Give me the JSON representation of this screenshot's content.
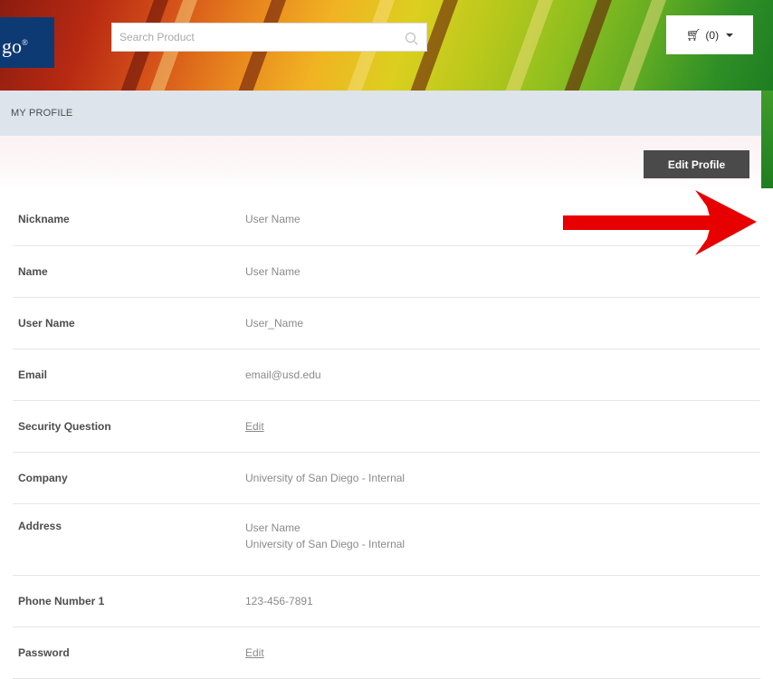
{
  "header": {
    "logo_text": "go",
    "logo_mark": "®",
    "search_placeholder": "Search Product",
    "search_icon": "search-icon",
    "cart_label": "(0)",
    "cart_icon": "cart-icon"
  },
  "page": {
    "title": "MY PROFILE",
    "edit_button": "Edit Profile"
  },
  "profile": {
    "nickname": {
      "label": "Nickname",
      "value": "User Name"
    },
    "name": {
      "label": "Name",
      "value": "User Name"
    },
    "username": {
      "label": "User Name",
      "value": "User_Name"
    },
    "email": {
      "label": "Email",
      "value": "email@usd.edu"
    },
    "security": {
      "label": "Security Question",
      "value": "Edit"
    },
    "company": {
      "label": "Company",
      "value": "University of San Diego - Internal"
    },
    "address": {
      "label": "Address",
      "line1": "User Name",
      "line2": "University of San Diego - Internal"
    },
    "phone": {
      "label": "Phone Number 1",
      "value": "123-456-7891"
    },
    "password": {
      "label": "Password",
      "value": "Edit"
    }
  },
  "colors": {
    "arrow": "#e60000",
    "button": "#4a4a4a",
    "title_bar": "#dde4ec",
    "logo_bg": "#0e3a74"
  }
}
